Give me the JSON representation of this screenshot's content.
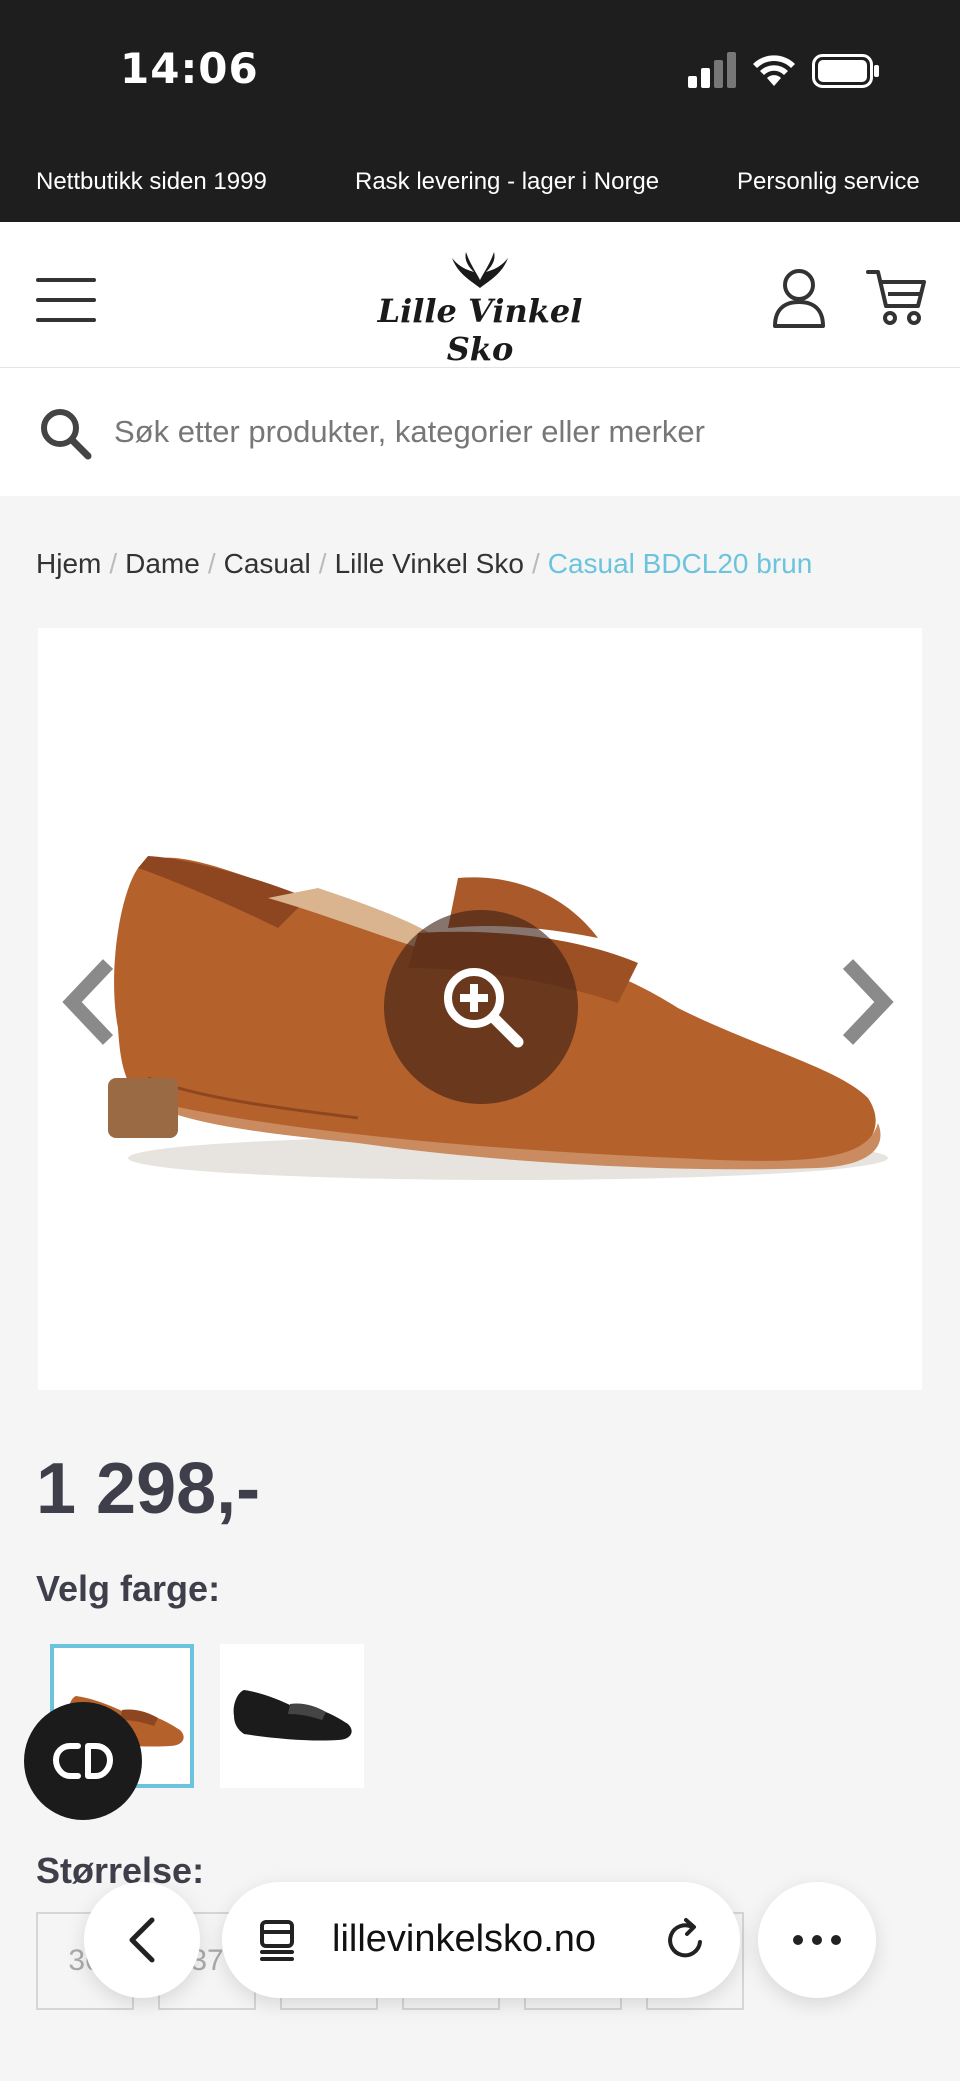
{
  "status_bar": {
    "time": "14:06"
  },
  "promo": [
    "Nettbutikk siden 1999",
    "Rask levering - lager i Norge",
    "Personlig service"
  ],
  "header": {
    "logo_text": "Lille Vinkel Sko"
  },
  "search": {
    "placeholder": "Søk etter produkter, kategorier eller merker"
  },
  "breadcrumb": {
    "items": [
      "Hjem",
      "Dame",
      "Casual",
      "Lille Vinkel Sko"
    ],
    "current": "Casual BDCL20 brun"
  },
  "product": {
    "price": "1 298,-",
    "color_label": "Velg farge:",
    "colors": [
      "brun",
      "svart"
    ],
    "size_label": "Størrelse:",
    "sizes": [
      "36",
      "37"
    ]
  },
  "browser": {
    "url": "lillevinkelsko.no"
  },
  "colors": {
    "accent": "#6cc4dc",
    "text_dark": "#3e3f4a",
    "leather": "#b5612c"
  },
  "icons": [
    "menu-icon",
    "user-icon",
    "cart-icon",
    "search-icon",
    "zoom-icon",
    "arrow-left-icon",
    "arrow-right-icon",
    "chat-icon",
    "back-icon",
    "tab-icon",
    "reload-icon",
    "more-icon"
  ]
}
